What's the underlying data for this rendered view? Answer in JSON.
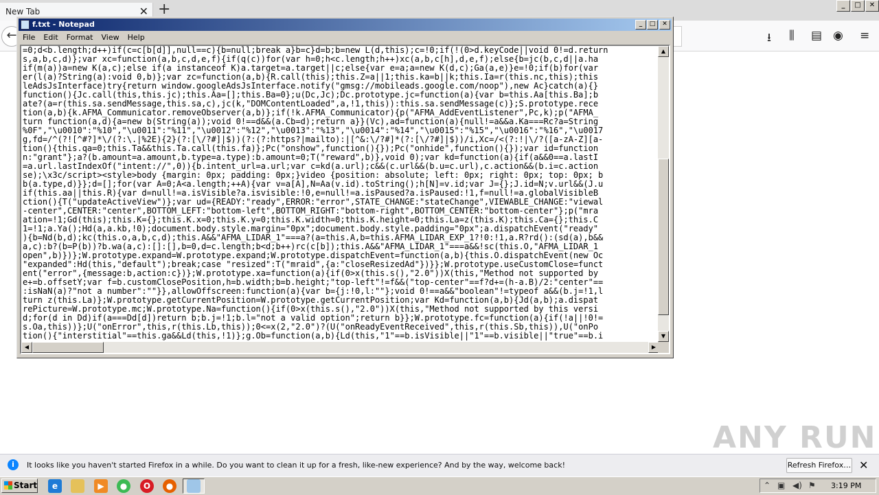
{
  "firefox": {
    "tab_label": "New Tab",
    "tab_close": "✕",
    "new_tab": "+",
    "back": "←",
    "toolbar_icons": [
      "download-icon",
      "library-icon",
      "sidebar-icon",
      "account-icon",
      "menu-icon"
    ]
  },
  "window_controls": {
    "minimize": "_",
    "maximize": "□",
    "close": "✕"
  },
  "notepad": {
    "title": "f.txt - Notepad",
    "menus": [
      "File",
      "Edit",
      "Format",
      "View",
      "Help"
    ],
    "lines": [
      "=0;d<b.length;d++)if(c=c[b[d]],null==c){b=null;break a}b=c}d=b;b=new L(d,this);c=!0;if(!(0>d.keyCode||void 0!=d.return",
      "s,a,b,c,d)};var xc=function(a,b,c,d,e,f){if(q(c))for(var h=0;h<c.length;h++)xc(a,b,c[h],d,e,f);else{b=jc(b,c,d||a.ha",
      "if(m(a))a=new K(a,c);else if(a instanceof K)a.target=a.target||c;else{var e=a;a=new K(d,c);Ga(a,e)}e=!0;if(b)for(var",
      "er(l(a)?String(a):void 0,b)};var zc=function(a,b){R.call(this);this.Z=a||1;this.ka=b||k;this.Ia=r(this.nc,this);this",
      "leAdsJsInterface)try{return window.googleAdsJsInterface.notify(\"gmsg://mobileads.google.com/noop\"),new Ac}catch(a){}",
      "function(){Jc.call(this,this.jc);this.Aa=[];this.Ba=0};u(Dc,Jc);Dc.prototype.jc=function(a){var b=this.Aa[this.Ba];b",
      "ate?(a=r(this.sa.sendMessage,this.sa,c),jc(k,\"DOMContentLoaded\",a,!1,this)):this.sa.sendMessage(c)};S.prototype.rece",
      "tion(a,b){k.AFMA_Communicator.removeObserver(a,b)};if(!k.AFMA_Communicator){p(\"AFMA_AddEventListener\",Pc,k);p(\"AFMA_",
      "turn function(a,d){a=new b(String(a));void 0!==d&&(a.Cb=d);return a}}(Vc),ad=function(a){null!=a&&a.Ka===Rc?a=String",
      "%0F\",\"\\u0010\":\"%10\",\"\\u0011\":\"%11\",\"\\u0012\":\"%12\",\"\\u0013\":\"%13\",\"\\u0014\":\"%14\",\"\\u0015\":\"%15\",\"\\u0016\":\"%16\",\"\\u0017",
      "g,fd=/^(?![^#?]*\\/(?:\\.|%2E){2}(?:[\\/?#]|$))(?:(?:https?|mailto):|[^&:\\/?#]*(?:[\\/?#]|$))/i,Xc=/<(?:!|\\/?([a-zA-Z][a-",
      "tion(){this.qa=0;this.Ta&&this.Ta.call(this.fa)};Pc(\"onshow\",function(){});Pc(\"onhide\",function(){});var id=function",
      "n:\"grant\"};a?(b.amount=a.amount,b.type=a.type):b.amount=0;T(\"reward\",b)},void 0);var kd=function(a){if(a&&0==a.lastI",
      "=a.url.lastIndexOf(\"intent://\",0)){b.intent_url=a.url;var c=kd(a.url);c&&(c.url&&(b.u=c.url),c.action&&(b.i=c.action",
      "se);\\x3c/script><style>body {margin: 0px; padding: 0px;}video {position: absolute; left: 0px; right: 0px; top: 0px; b",
      "b(a.type,d)}};d=[];for(var A=0;A<a.length;++A){var v=a[A],N=Aa(v.id).toString();h[N]=v.id;var J={};J.id=N;v.url&&(J.u",
      "if(this.aa||this.R){var d=null!=a.isVisible?a.isvisible:!0,e=null!=a.isPaused?a.isPaused:!1,f=null!=a.globalVisibleB",
      "ction(){T(\"updateActiveView\")};var ud={READY:\"ready\",ERROR:\"error\",STATE_CHANGE:\"stateChange\",VIEWABLE_CHANGE:\"viewal",
      "-center\",CENTER:\"center\",BOTTOM_LEFT:\"bottom-left\",BOTTOM_RIGHT:\"bottom-right\",BOTTOM_CENTER:\"bottom-center\"};p(\"mra",
      "ation=!1;Gd(this);this.K={};this.K.x=0;this.K.y=0;this.K.width=0;this.K.height=0;this.La=z(this.K);this.Ca={};this.C",
      "1=!1;a.Ya();Hd(a,a.kb,!0);document.body.style.margin=\"0px\";document.body.style.padding=\"0px\";a.dispatchEvent(\"ready\"",
      "){b=Nd(b,d);kc(this.o,a,b,c,d);this.A&&\"AFMA_LIDAR_1\"===a?(a=this.A,b=this.AFMA_LIDAR_EXP_1?!0:!1,a.R?rd():(sd(a),b&&",
      "a,c):b?(b=P(b))?b.wa(a,c):[]:[],b=0,d=c.length;b<d;b++)rc(c[b]);this.A&&\"AFMA_LIDAR_1\"===a&&!sc(this.O,\"AFMA_LIDAR_1",
      "open\",b)})};W.prototype.expand=W.prototype.expand;W.prototype.dispatchEvent=function(a,b){this.O.dispatchEvent(new Oc",
      "\"expanded\":Hd(this,\"default\");break;case \"resized\":T(\"mraid\",{a:\"closeResizedAd\"})}};W.prototype.useCustomClose=funct",
      "ent(\"error\",{message:b,action:c})};W.prototype.xa=function(a){if(0>x(this.s(),\"2.0\"))X(this,\"Method not supported by ",
      "e+=b.offsetY;var f=b.customClosePosition,h=b.width;b=b.height;\"top-left\"!=f&&(\"top-center\"==f?d+=(h-a.B)/2:\"center\"==",
      ":isNaN(a)?\"not a number\":\"\"}},allowOffscreen:function(a){var b={j:!0,l:\"\"};void 0!==a&&\"boolean\"!=typeof a&&(b.j=!1,l",
      "turn z(this.La)};W.prototype.getCurrentPosition=W.prototype.getCurrentPosition;var Kd=function(a,b){Jd(a,b);a.dispat",
      "rePicture=W.prototype.mc;W.prototype.Na=function(){if(0>x(this.s(),\"2.0\"))X(this,\"Method not supported by this versi",
      "d;for(d in Dd)if(a===Dd[d])return b;b.j=!1;b.l=\"not a valid option\";return b}};W.prototype.fc=function(a){if(!a||!0!=",
      "s.Oa,this))};U(\"onError\",this,r(this.Lb,this));0<=x(2,\"2.0\")?(U(\"onReadyEventReceived\",this,r(this.Sb,this)),U(\"onPo",
      "tion(){\"interstitial\"==this.ga&&Ld(this,!1)};g.Ob=function(a,b){Ld(this,\"1\"==b.isVisible||\"1\"==b.visible||\"true\"==b.i"
    ]
  },
  "notification": {
    "icon": "i",
    "message": "It looks like you haven't started Firefox in a while. Do you want to clean it up for a fresh, like-new experience? And by the way, welcome back!",
    "button": "Refresh Firefox…",
    "close": "✕"
  },
  "taskbar": {
    "start": "Start",
    "apps": [
      "ie-icon",
      "folder-icon",
      "media-player-icon",
      "chrome-icon",
      "opera-icon",
      "firefox-icon",
      "notepad-icon"
    ],
    "clock": "3:19 PM"
  },
  "watermark": "ANY RUN"
}
